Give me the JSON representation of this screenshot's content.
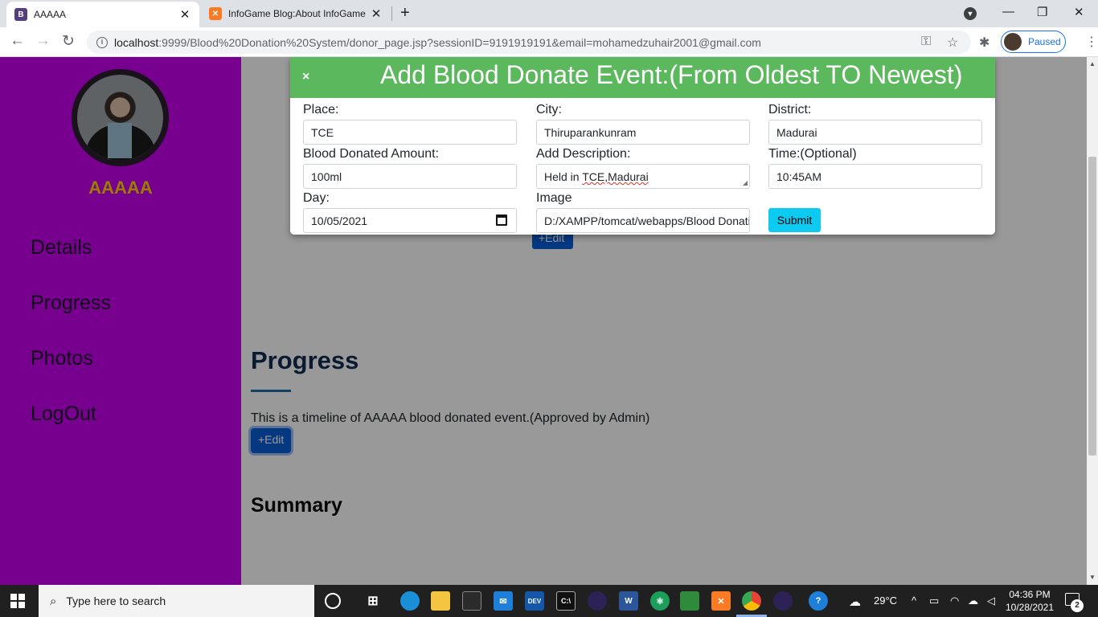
{
  "browser": {
    "tabs": [
      {
        "title": "AAAAA",
        "favicon": "B",
        "active": true
      },
      {
        "title": "InfoGame Blog:About InfoGame",
        "favicon": "X",
        "active": false
      }
    ],
    "url_host": "localhost",
    "url_rest": ":9999/Blood%20Donation%20System/donor_page.jsp?sessionID=9191919191&email=mohamedzuhair2001@gmail.com",
    "profile_status": "Paused"
  },
  "sidebar": {
    "user_name": "AAAAA",
    "links": [
      "Details",
      "Progress",
      "Photos",
      "LogOut"
    ]
  },
  "main": {
    "behind_edit_label": "+Edit",
    "progress_title": "Progress",
    "progress_text": "This is a timeline of AAAAA blood donated event.(Approved by Admin)",
    "edit_label": "+Edit",
    "summary_title": "Summary"
  },
  "modal": {
    "close_label": "×",
    "title": "Add Blood Donate Event:(From Oldest TO Newest)",
    "fields": {
      "place": {
        "label": "Place:",
        "value": "TCE"
      },
      "city": {
        "label": "City:",
        "value": "Thiruparankunram"
      },
      "district": {
        "label": "District:",
        "value": "Madurai"
      },
      "amount": {
        "label": "Blood Donated Amount:",
        "value": "100ml"
      },
      "description": {
        "label": "Add Description:",
        "value_prefix": "Held in ",
        "value_underlined": "TCE,Madurai"
      },
      "time": {
        "label": "Time:(Optional)",
        "value": "10:45AM"
      },
      "day": {
        "label": "Day:",
        "value": "10/05/2021"
      },
      "image": {
        "label": "Image",
        "value": "D:/XAMPP/tomcat/webapps/Blood Donation"
      }
    },
    "submit_label": "Submit"
  },
  "taskbar": {
    "search_placeholder": "Type here to search",
    "temperature": "29°C",
    "time": "04:36 PM",
    "date": "10/28/2021",
    "notifications": "2"
  },
  "colors": {
    "sidebar_bg": "#c700ee",
    "user_name": "#ffd400",
    "modal_header": "#5cb85c",
    "primary_button": "#0b5ed7",
    "submit_button": "#0dcaf0"
  }
}
